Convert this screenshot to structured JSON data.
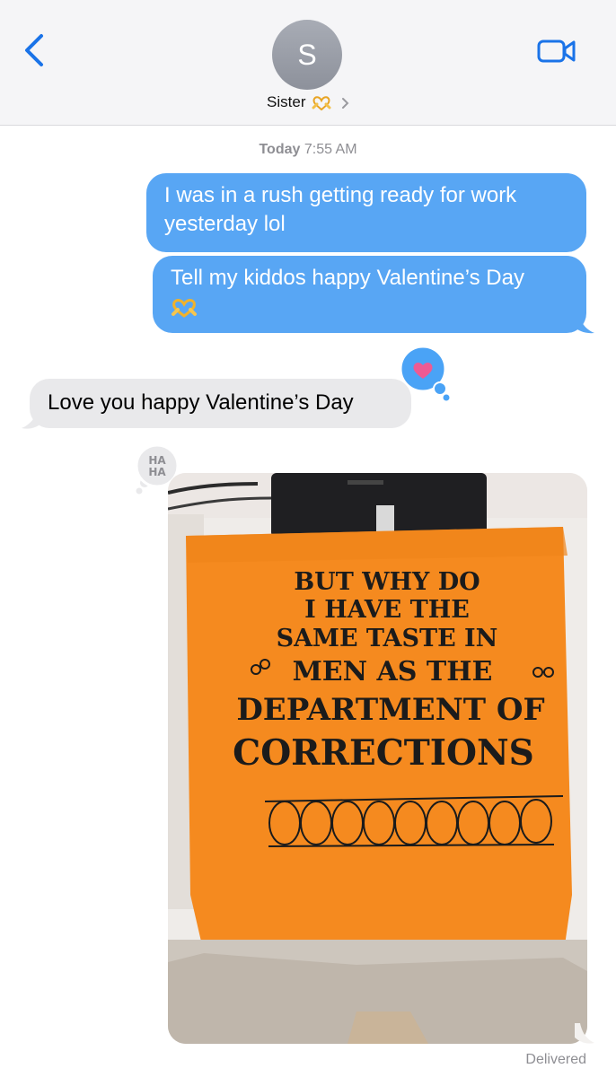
{
  "header": {
    "avatar_initial": "S",
    "contact_name": "Sister",
    "icons": [
      "back-chevron-icon",
      "facetime-video-icon",
      "heart-hands-emoji",
      "chevron-right-icon"
    ],
    "accent_color": "#1a73e8"
  },
  "timestamp": {
    "day": "Today",
    "time": "7:55 AM"
  },
  "messages": [
    {
      "direction": "outgoing",
      "text_line1": "I was in a rush getting ready for work",
      "text_line2": "yesterday lol"
    },
    {
      "direction": "outgoing",
      "text": "Tell my kiddos happy Valentine’s Day",
      "emoji": "heart-hands-emoji"
    },
    {
      "direction": "incoming",
      "text": "Love you happy Valentine’s Day",
      "tapback": "heart-tapback-icon"
    }
  ],
  "attachment": {
    "kind": "photo",
    "tapback": "haha-tapback-icon",
    "tapback_text": "HA HA",
    "shirt_text": [
      "BUT WHY DO",
      "I HAVE THE",
      "SAME TASTE IN",
      "MEN AS THE",
      "DEPARTMENT OF",
      "CORRECTIONS"
    ],
    "shirt_color": "#f58a1f"
  },
  "status": "Delivered",
  "colors": {
    "outgoing_bubble": "#58a6f4",
    "incoming_bubble": "#e9e9eb",
    "header_bg": "#f5f5f7"
  }
}
